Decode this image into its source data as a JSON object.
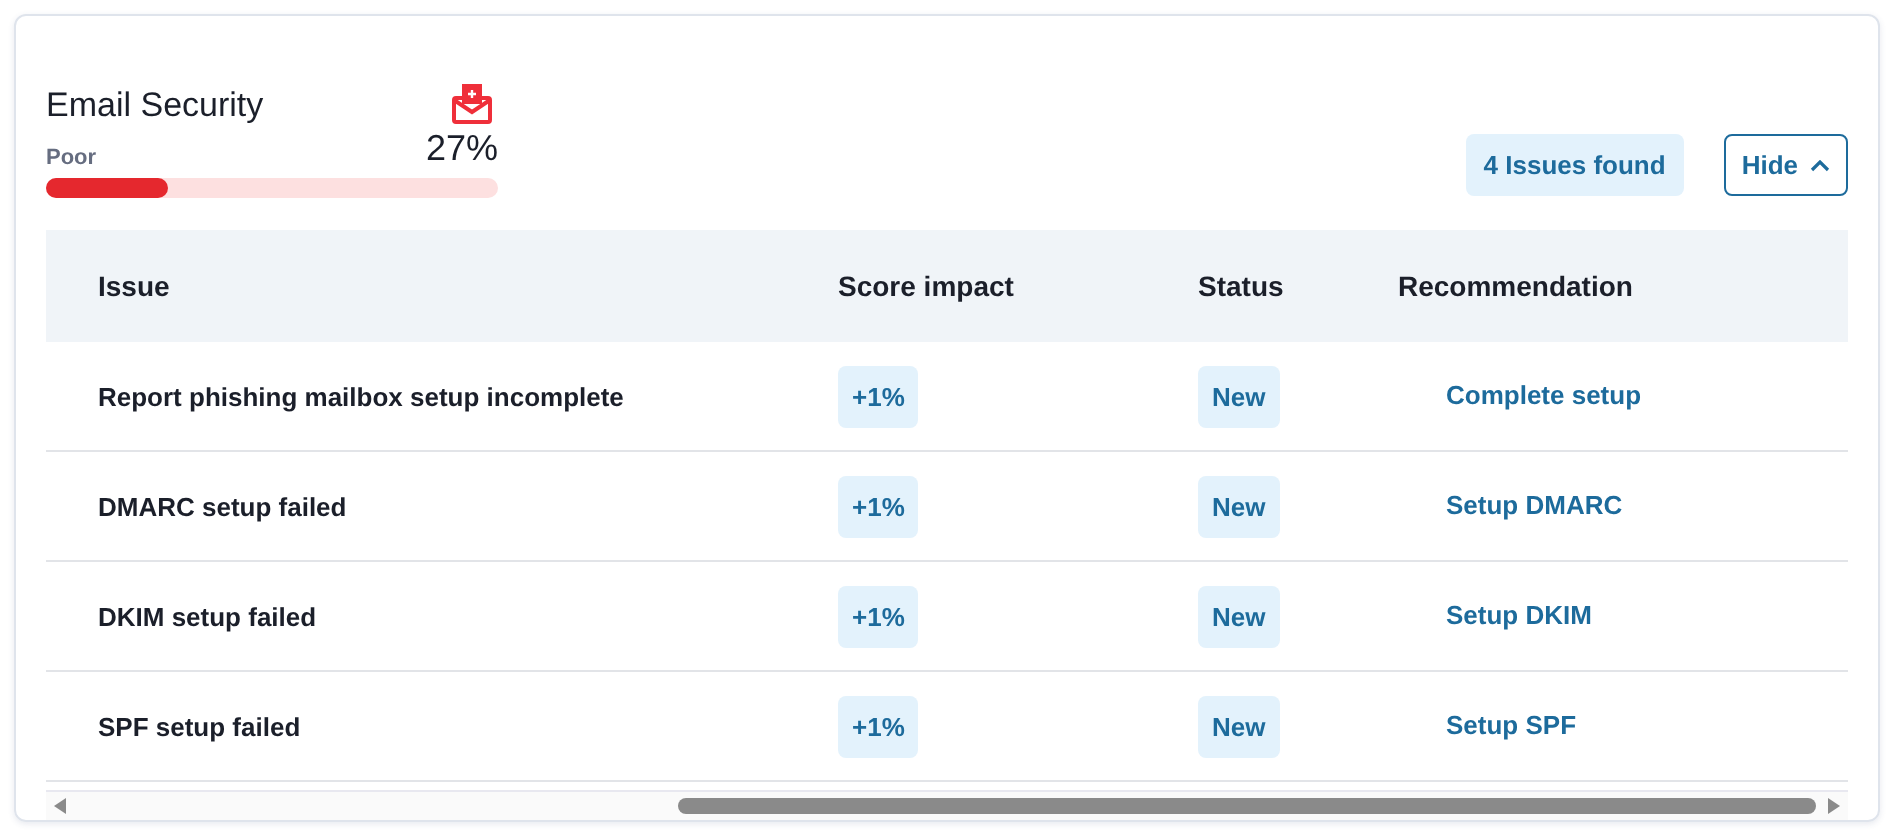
{
  "card": {
    "title": "Email Security",
    "rating": "Poor",
    "score": "27%",
    "level": 0.27,
    "issues_badge": "4 Issues found",
    "toggle_button": {
      "label": "Hide",
      "expanded": true
    }
  },
  "table": {
    "columns": [
      "Issue",
      "Score impact",
      "Status",
      "Recommendation"
    ],
    "rows": [
      {
        "issue": "Report phishing mailbox setup incomplete",
        "impact": "+1%",
        "status": "New",
        "recommendation": "Complete setup"
      },
      {
        "issue": "DMARC setup failed",
        "impact": "+1%",
        "status": "New",
        "recommendation": "Setup DMARC"
      },
      {
        "issue": "DKIM setup failed",
        "impact": "+1%",
        "status": "New",
        "recommendation": "Setup DKIM"
      },
      {
        "issue": "SPF setup failed",
        "impact": "+1%",
        "status": "New",
        "recommendation": "Setup SPF"
      }
    ]
  }
}
